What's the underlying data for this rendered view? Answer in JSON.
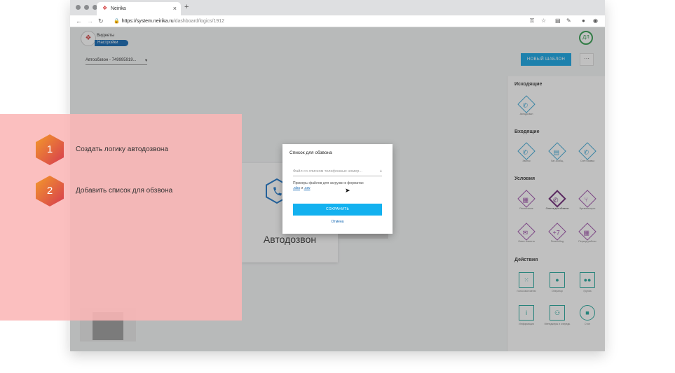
{
  "browser": {
    "tab_title": "Neirika",
    "new_tab_label": "+",
    "url_host": "https://system.neirika.ru",
    "url_path": "/dashboard/logics/1912"
  },
  "app": {
    "logo_line1": "Виджеты",
    "logo_line2": "Настройки",
    "avatar_initials": "ДЛ",
    "logic_select_value": "Автообзвон - 749995919...",
    "new_template_button": "НОВЫЙ ШАБЛОН",
    "more_button": "···"
  },
  "canvas": {
    "node_label": "Автодозвон"
  },
  "panel": {
    "outgoing_title": "Исходящие",
    "outgoing_items": [
      {
        "label": "Автодозвон",
        "icon": "phone-outgoing-icon"
      }
    ],
    "incoming_title": "Входящие",
    "incoming_items": [
      {
        "label": "Звонок",
        "icon": "phone-incoming-icon"
      },
      {
        "label": "Чат-сообщ.",
        "icon": "chat-icon"
      },
      {
        "label": "Счет/Заявка",
        "icon": "phone-incoming-icon"
      }
    ],
    "conditions_title": "Условия",
    "conditions_items": [
      {
        "label": "Расписание",
        "icon": "calendar-icon"
      },
      {
        "label": "Список для обзвона",
        "icon": "phone-list-icon"
      },
      {
        "label": "Время/вопрос",
        "icon": "branch-icon"
      },
      {
        "label": "Ответ клиента",
        "icon": "message-icon"
      },
      {
        "label": "Регион/Код",
        "icon": "plus-seven-icon"
      },
      {
        "label": "Период работы",
        "icon": "calendar-clock-icon"
      }
    ],
    "actions_title": "Действия",
    "actions_items": [
      {
        "label": "Голосовое меню",
        "icon": "keypad-icon"
      },
      {
        "label": "Оператор",
        "icon": "user-icon"
      },
      {
        "label": "Группа",
        "icon": "group-icon"
      },
      {
        "label": "Информация",
        "icon": "info-icon"
      },
      {
        "label": "Менеджеры и очередь",
        "icon": "people-icon"
      },
      {
        "label": "Стоп",
        "icon": "stop-icon"
      }
    ]
  },
  "modal": {
    "title": "Список для обзвона",
    "file_field_placeholder": "Файл со списком телефонных номер...",
    "hint_text": "Примеры файлов для загрузки в форматах",
    "hint_link_xlsx": ".xlsx",
    "hint_and": "и",
    "hint_link_csv": ".csv",
    "save_button": "СОХРАНИТЬ",
    "cancel_link": "Отмена"
  },
  "tutorial": {
    "steps": [
      {
        "number": "1",
        "text": "Создать логику автодозвона"
      },
      {
        "number": "2",
        "text": "Добавить список для обзвона"
      }
    ],
    "accent_color": "#e8463c"
  }
}
